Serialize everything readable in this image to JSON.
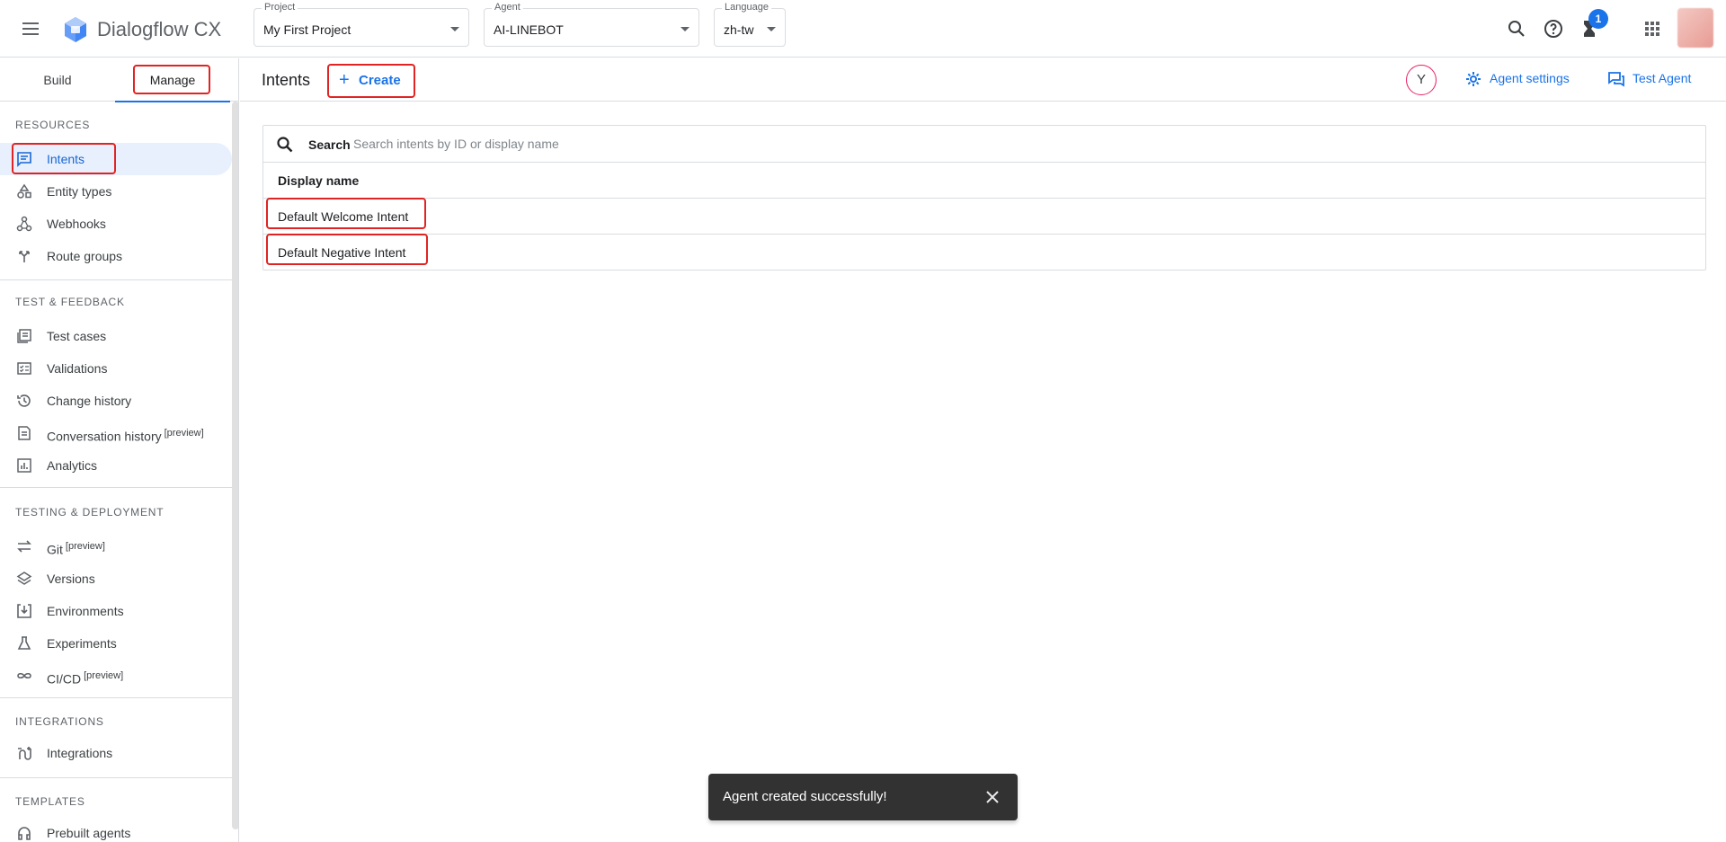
{
  "app": {
    "title": "Dialogflow CX"
  },
  "selectors": {
    "project": {
      "label": "Project",
      "value": "My First Project"
    },
    "agent": {
      "label": "Agent",
      "value": "AI-LINEBOT"
    },
    "language": {
      "label": "Language",
      "value": "zh-tw"
    }
  },
  "notifications": {
    "count": "1"
  },
  "tabs": {
    "build": "Build",
    "manage": "Manage",
    "active": "Manage"
  },
  "sidebar": {
    "resources": {
      "title": "RESOURCES",
      "items": [
        {
          "label": "Intents",
          "icon": "intents-icon",
          "active": true
        },
        {
          "label": "Entity types",
          "icon": "entity-types-icon"
        },
        {
          "label": "Webhooks",
          "icon": "webhooks-icon"
        },
        {
          "label": "Route groups",
          "icon": "route-groups-icon"
        }
      ]
    },
    "test_feedback": {
      "title": "TEST & FEEDBACK",
      "items": [
        {
          "label": "Test cases",
          "icon": "test-cases-icon"
        },
        {
          "label": "Validations",
          "icon": "validations-icon"
        },
        {
          "label": "Change history",
          "icon": "history-icon"
        },
        {
          "label": "Conversation history",
          "tag": "[preview]",
          "icon": "conversation-history-icon"
        },
        {
          "label": "Analytics",
          "icon": "analytics-icon"
        }
      ]
    },
    "testing_deployment": {
      "title": "TESTING & DEPLOYMENT",
      "items": [
        {
          "label": "Git",
          "tag": "[preview]",
          "icon": "git-icon"
        },
        {
          "label": "Versions",
          "icon": "versions-icon"
        },
        {
          "label": "Environments",
          "icon": "environments-icon"
        },
        {
          "label": "Experiments",
          "icon": "experiments-icon"
        },
        {
          "label": "CI/CD",
          "tag": "[preview]",
          "icon": "cicd-icon"
        }
      ]
    },
    "integrations": {
      "title": "INTEGRATIONS",
      "items": [
        {
          "label": "Integrations",
          "icon": "integrations-icon"
        }
      ]
    },
    "templates": {
      "title": "TEMPLATES",
      "items": [
        {
          "label": "Prebuilt agents",
          "icon": "prebuilt-agents-icon"
        }
      ]
    }
  },
  "subheader": {
    "title": "Intents",
    "create_label": "Create",
    "user_initial": "Y",
    "agent_settings_label": "Agent settings",
    "test_agent_label": "Test Agent"
  },
  "table": {
    "search_label": "Search",
    "search_placeholder": "Search intents by ID or display name",
    "column_header": "Display name",
    "rows": [
      "Default Welcome Intent",
      "Default Negative Intent"
    ]
  },
  "snackbar": {
    "message": "Agent created successfully!"
  },
  "colors": {
    "accent": "#1a73e8",
    "highlight": "#e02424",
    "active_bg": "#e8f0fe",
    "snackbar_bg": "#323232"
  }
}
